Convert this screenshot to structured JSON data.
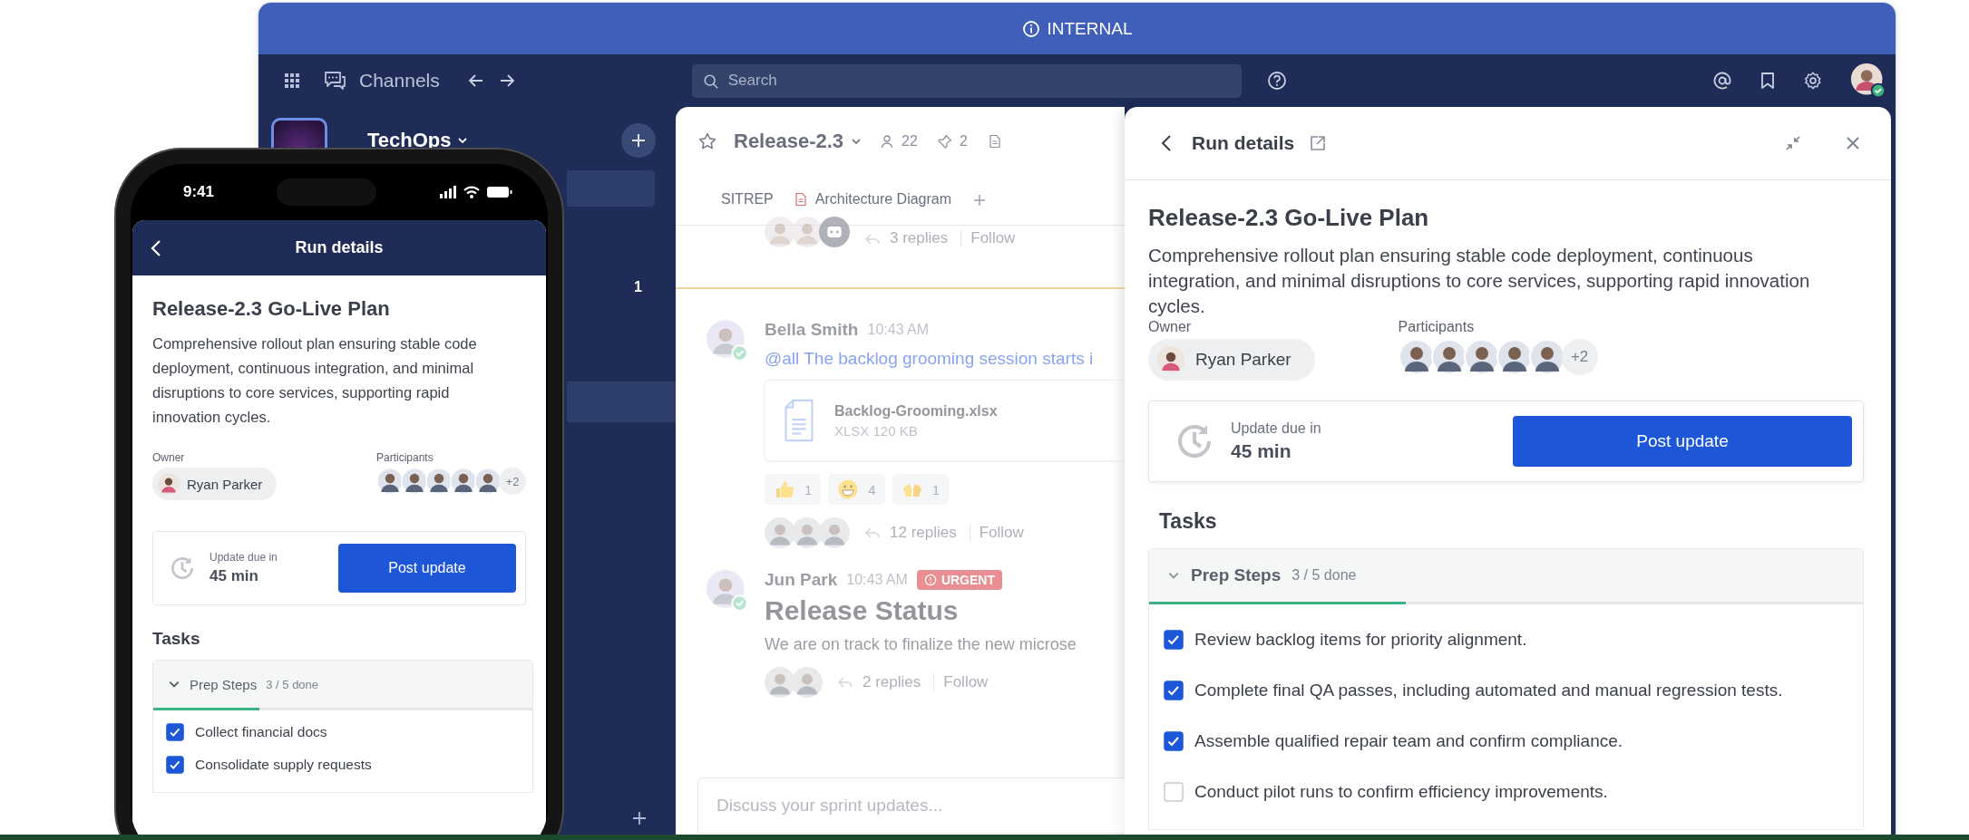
{
  "banner": {
    "label": "INTERNAL"
  },
  "nav": {
    "title": "Channels",
    "search": {
      "placeholder": "Search"
    }
  },
  "sidebar": {
    "workspace": "TechOps",
    "count": "1"
  },
  "channel": {
    "name": "Release-2.3",
    "members": "22",
    "pins": "2",
    "tabs": [
      {
        "kind": "text",
        "label": "SITREP",
        "selected": false
      },
      {
        "kind": "doc",
        "label": "Architecture Diagram",
        "selected": false
      }
    ],
    "thread_tail": {
      "repliers": [
        {
          "kind": "person"
        },
        {
          "kind": "person"
        },
        {
          "kind": "bot"
        }
      ],
      "replies": "3 replies",
      "follow": "Follow"
    },
    "messages": [
      {
        "author": "Bella Smith",
        "time": "10:43 AM",
        "text": "@all The backlog grooming session starts i",
        "file": {
          "name": "Backlog-Grooming.xlsx",
          "meta": "XLSX 120 KB"
        },
        "reactions": [
          {
            "kind": "thumbs_up",
            "count": "1"
          },
          {
            "kind": "grin",
            "count": "4"
          },
          {
            "kind": "raised_hands",
            "count": "1"
          }
        ],
        "thread": {
          "repliers": [
            {
              "kind": "person"
            },
            {
              "kind": "person"
            },
            {
              "kind": "person"
            }
          ],
          "replies": "12 replies",
          "follow": "Follow"
        }
      },
      {
        "author": "Jun Park",
        "time": "10:43 AM",
        "badge": "URGENT",
        "heading": "Release Status",
        "body": "We are on track to finalize the new microse",
        "thread": {
          "repliers": [
            {
              "kind": "person"
            },
            {
              "kind": "person"
            }
          ],
          "replies": "2 replies",
          "follow": "Follow"
        }
      }
    ],
    "composer": {
      "placeholder": "Discuss your sprint updates..."
    }
  },
  "run_panel": {
    "header": "Run details",
    "title": "Release-2.3 Go-Live Plan",
    "description": "Comprehensive rollout plan ensuring stable code deployment, continuous integration, and minimal disruptions to core services, supporting rapid innovation cycles.",
    "owner_label": "Owner",
    "owner": "Ryan Parker",
    "participants_label": "Participants",
    "participants_more": "+2",
    "update_label": "Update due in",
    "update_value": "45 min",
    "button": "Post update",
    "tasks_heading": "Tasks",
    "group": {
      "name": "Prep Steps",
      "progress": "3 / 5 done",
      "expanded": true,
      "level": 0.36,
      "items": [
        {
          "text": "Review backlog items for priority alignment.",
          "checked": true
        },
        {
          "text": "Complete final QA passes, including automated and manual regression tests.",
          "checked": true
        },
        {
          "text": "Assemble qualified repair team and confirm compliance.",
          "checked": true
        },
        {
          "text": "Conduct pilot runs to confirm efficiency improvements.",
          "checked": false
        }
      ]
    }
  },
  "phone": {
    "time": "9:41",
    "header": "Run details",
    "title": "Release-2.3 Go-Live Plan",
    "description": "Comprehensive rollout plan ensuring stable code deployment, continuous integration, and minimal disruptions to core services, supporting rapid innovation cycles.",
    "owner_label": "Owner",
    "owner": "Ryan Parker",
    "participants_label": "Participants",
    "participants_more": "+2",
    "update_label": "Update due in",
    "update_value": "45 min",
    "button": "Post update",
    "tasks_heading": "Tasks",
    "group": {
      "name": "Prep Steps",
      "progress": "3 / 5 done",
      "expanded": true,
      "level": 0.28,
      "items": [
        {
          "text": "Collect financial docs",
          "checked": true
        },
        {
          "text": "Consolidate supply requests",
          "checked": true
        }
      ]
    }
  }
}
